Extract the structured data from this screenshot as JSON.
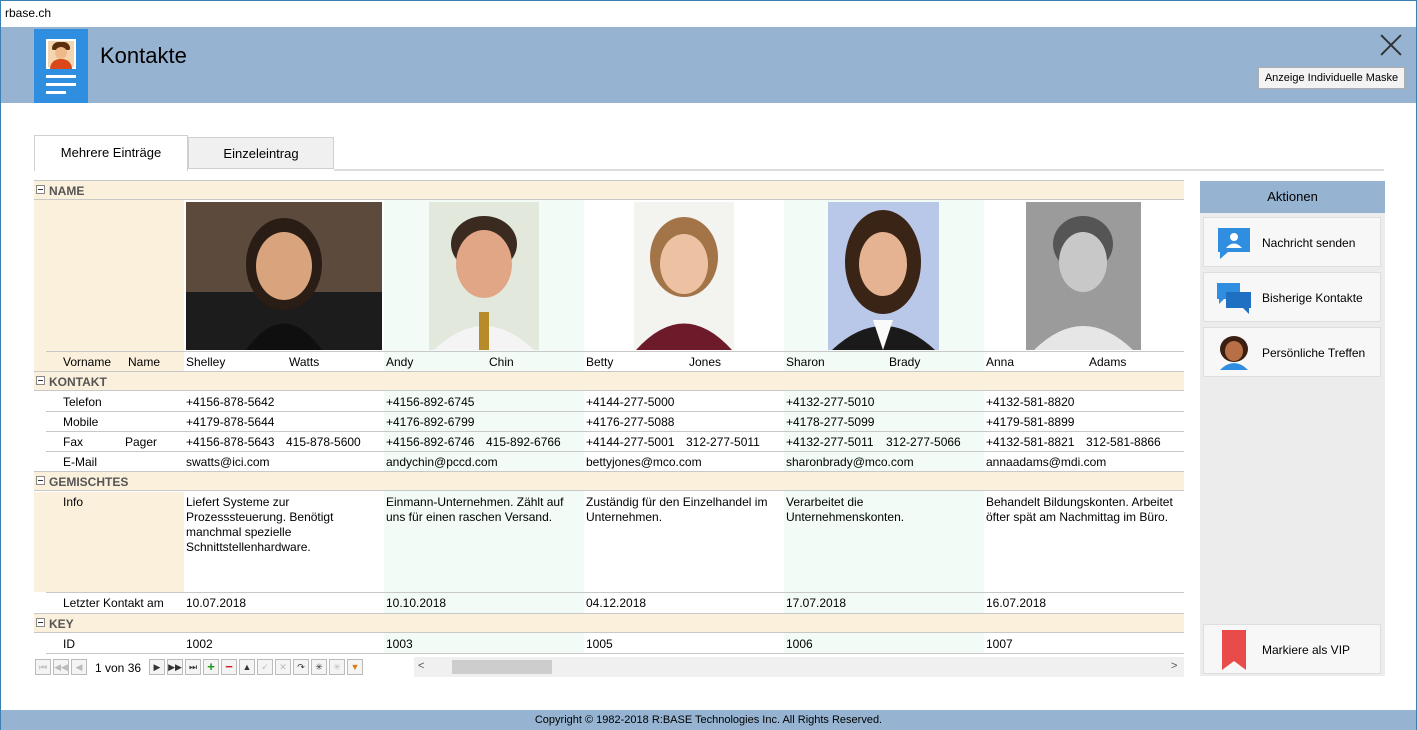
{
  "window_title": "rbase.ch",
  "header": {
    "title": "Kontakte",
    "mask_button": "Anzeige Individuelle Maske"
  },
  "tabs": [
    {
      "label": "Mehrere Einträge",
      "active": true
    },
    {
      "label": "Einzeleintrag",
      "active": false
    }
  ],
  "sections": {
    "name": "NAME",
    "kontakt": "KONTAKT",
    "gemischtes": "GEMISCHTES",
    "key": "KEY"
  },
  "labels": {
    "vorname": "Vorname",
    "name": "Name",
    "telefon": "Telefon",
    "mobile": "Mobile",
    "fax": "Fax",
    "pager": "Pager",
    "email": "E-Mail",
    "info": "Info",
    "letzter_kontakt": "Letzter Kontakt am",
    "id": "ID"
  },
  "contacts": [
    {
      "vorname": "Shelley",
      "name": "Watts",
      "telefon": "+4156-878-5642",
      "mobile": "+4179-878-5644",
      "fax": "+4156-878-5643",
      "pager": "415-878-5600",
      "email": "swatts@ici.com",
      "info": "Liefert Systeme zur Prozesssteuerung. Benötigt manchmal spezielle Schnittstellenhardware.",
      "letzter_kontakt": "10.07.2018",
      "id": "1002"
    },
    {
      "vorname": "Andy",
      "name": "Chin",
      "telefon": "+4156-892-6745",
      "mobile": "+4176-892-6799",
      "fax": "+4156-892-6746",
      "pager": "415-892-6766",
      "email": "andychin@pccd.com",
      "info": "Einmann-Unternehmen. Zählt auf uns für einen raschen Versand.",
      "letzter_kontakt": "10.10.2018",
      "id": "1003"
    },
    {
      "vorname": "Betty",
      "name": "Jones",
      "telefon": "+4144-277-5000",
      "mobile": "+4176-277-5088",
      "fax": "+4144-277-5001",
      "pager": "312-277-5011",
      "email": "bettyjones@mco.com",
      "info": "Zuständig für den Einzelhandel im Unternehmen.",
      "letzter_kontakt": "04.12.2018",
      "id": "1005"
    },
    {
      "vorname": "Sharon",
      "name": "Brady",
      "telefon": "+4132-277-5010",
      "mobile": "+4178-277-5099",
      "fax": "+4132-277-5011",
      "pager": "312-277-5066",
      "email": "sharonbrady@mco.com",
      "info": "Verarbeitet die Unternehmenskonten.",
      "letzter_kontakt": "17.07.2018",
      "id": "1006"
    },
    {
      "vorname": "Anna",
      "name": "Adams",
      "telefon": "+4132-581-8820",
      "mobile": "+4179-581-8899",
      "fax": "+4132-581-8821",
      "pager": "312-581-8866",
      "email": "annaadams@mdi.com",
      "info": "Behandelt Bildungskonten. Arbeitet öfter spät am Nachmittag im Büro.",
      "letzter_kontakt": "16.07.2018",
      "id": "1007"
    }
  ],
  "navigator": {
    "position": "1 von 36"
  },
  "actions": {
    "title": "Aktionen",
    "items": [
      "Nachricht senden",
      "Bisherige Kontakte",
      "Persönliche Treffen",
      "Markiere als VIP"
    ]
  },
  "footer": "Copyright © 1982-2018 R:BASE Technologies Inc. All Rights Reserved.",
  "colors": {
    "header": "#96b4d2",
    "band": "#fbf0dc",
    "accent": "#2f8ee0",
    "vip": "#e94b4b"
  }
}
